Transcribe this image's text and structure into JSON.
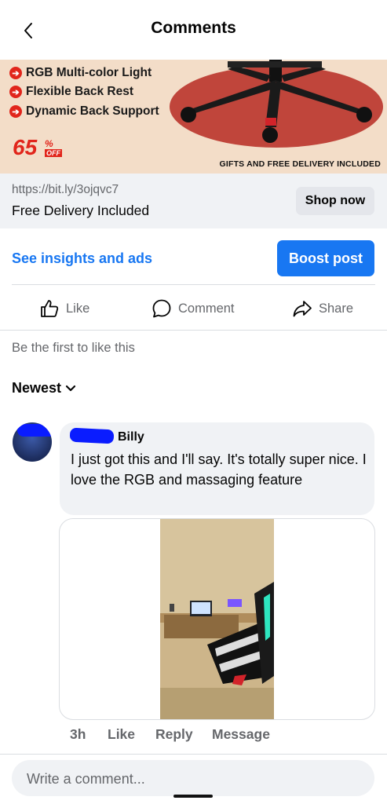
{
  "header": {
    "title": "Comments"
  },
  "ad": {
    "features": [
      "RGB Multi-color Light",
      "Flexible Back Rest",
      "Dynamic Back Support"
    ],
    "discount": "65",
    "discount_pct": "%",
    "discount_off": "OFF",
    "tagline": "GIFTS AND FREE DELIVERY INCLUDED"
  },
  "link": {
    "url": "https://bit.ly/3ojqvc7",
    "title": "Free Delivery Included",
    "cta": "Shop now"
  },
  "post_actions": {
    "insights": "See insights and ads",
    "boost": "Boost post",
    "like": "Like",
    "comment": "Comment",
    "share": "Share"
  },
  "reactions_text": "Be the first to like this",
  "sort_label": "Newest",
  "comment": {
    "author": "Billy",
    "text": "I just got this and I'll say. It's totally super nice. I love the RGB and massaging feature",
    "time": "3h",
    "like": "Like",
    "reply": "Reply",
    "message": "Message"
  },
  "composer": {
    "placeholder": "Write a comment..."
  },
  "colors": {
    "accent": "#1877f2",
    "ad_background": "#f3ddc8",
    "ad_red": "#e1251b"
  }
}
